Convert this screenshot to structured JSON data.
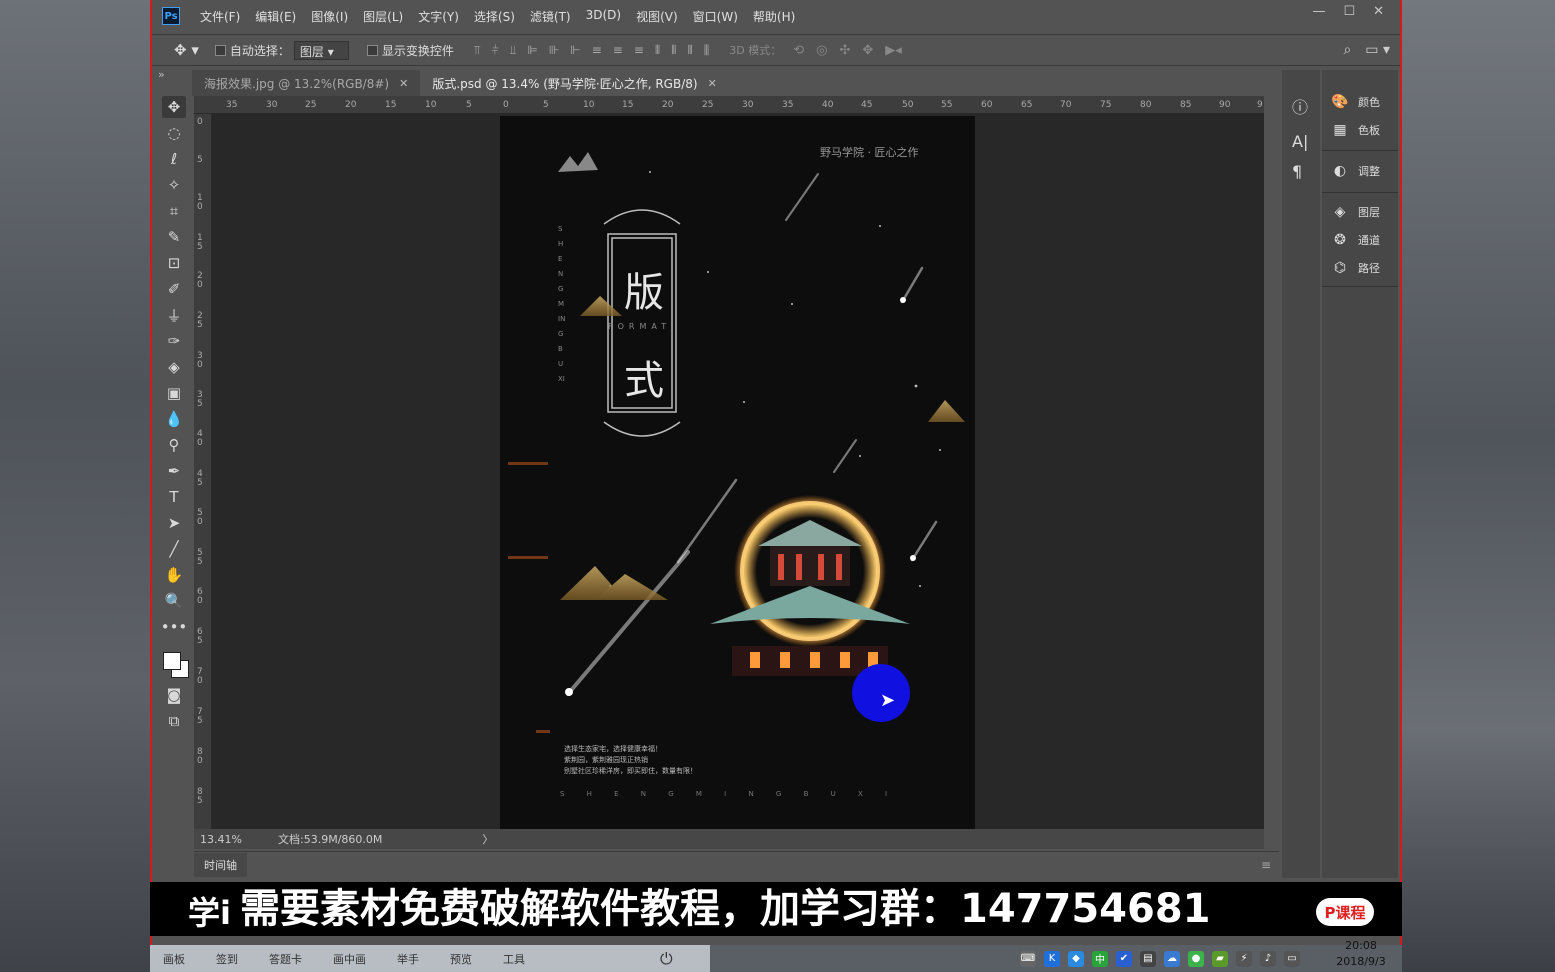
{
  "app": {
    "logo": "Ps",
    "menus": [
      "文件(F)",
      "编辑(E)",
      "图像(I)",
      "图层(L)",
      "文字(Y)",
      "选择(S)",
      "滤镜(T)",
      "3D(D)",
      "视图(V)",
      "窗口(W)",
      "帮助(H)"
    ]
  },
  "options_bar": {
    "auto_select_label": "自动选择：",
    "auto_select_value": "图层",
    "show_transform_label": "显示变换控件",
    "mode_3d_label": "3D 模式："
  },
  "tabs": [
    {
      "label": "海报效果.jpg @ 13.2%(RGB/8#)",
      "active": false
    },
    {
      "label": "版式.psd @ 13.4% (野马学院·匠心之作, RGB/8)",
      "active": true
    }
  ],
  "ruler": {
    "h_ticks": [
      "35",
      "30",
      "25",
      "20",
      "15",
      "10",
      "5",
      "0",
      "5",
      "10",
      "15",
      "20",
      "25",
      "30",
      "35",
      "40",
      "45",
      "50",
      "55",
      "60",
      "65",
      "70",
      "75",
      "80",
      "85",
      "90",
      "9"
    ],
    "v_ticks": [
      "0",
      "5",
      "10",
      "15",
      "20",
      "25",
      "30",
      "35",
      "40",
      "45",
      "50",
      "55",
      "60",
      "65",
      "70",
      "75",
      "80",
      "85"
    ]
  },
  "poster": {
    "header": "野马学院 · 匠心之作",
    "char1": "版",
    "char2": "式",
    "format": "FORMAT",
    "vertical_pinyin": "SHENGMINGBUXI",
    "body_lines": [
      "选择生态家宅，选择健康幸福！",
      "紫荆园，紫荆雅园现正热销",
      "别墅社区珍稀洋房，即买即住，数量有限！"
    ],
    "footer": "S H E N G M I N G B U X I"
  },
  "status": {
    "zoom": "13.41%",
    "doc": "文档:53.9M/860.0M",
    "arrow": "〉"
  },
  "timeline": {
    "label": "时间轴"
  },
  "panels": [
    {
      "icon": "palette-icon",
      "label": "颜色"
    },
    {
      "icon": "grid-icon",
      "label": "色板"
    },
    {
      "icon": "adjust-icon",
      "label": "调整"
    },
    {
      "icon": "layers-icon",
      "label": "图层"
    },
    {
      "icon": "channels-icon",
      "label": "通道"
    },
    {
      "icon": "paths-icon",
      "label": "路径"
    }
  ],
  "subtitle": {
    "prefix": "学i",
    "text": "需要素材免费破解软件教程，加学习群：147754681",
    "badge": "P课程"
  },
  "bottombar": {
    "items": [
      "画板",
      "签到",
      "答题卡",
      "画中画",
      "举手",
      "预览",
      "工具"
    ]
  },
  "clock": {
    "time": "20:08",
    "date": "2018/9/3"
  },
  "colors": {
    "accent": "#d41a1a",
    "ps_bg": "#535353",
    "canvas_bg": "#282828",
    "glow": "#ffb84d"
  }
}
